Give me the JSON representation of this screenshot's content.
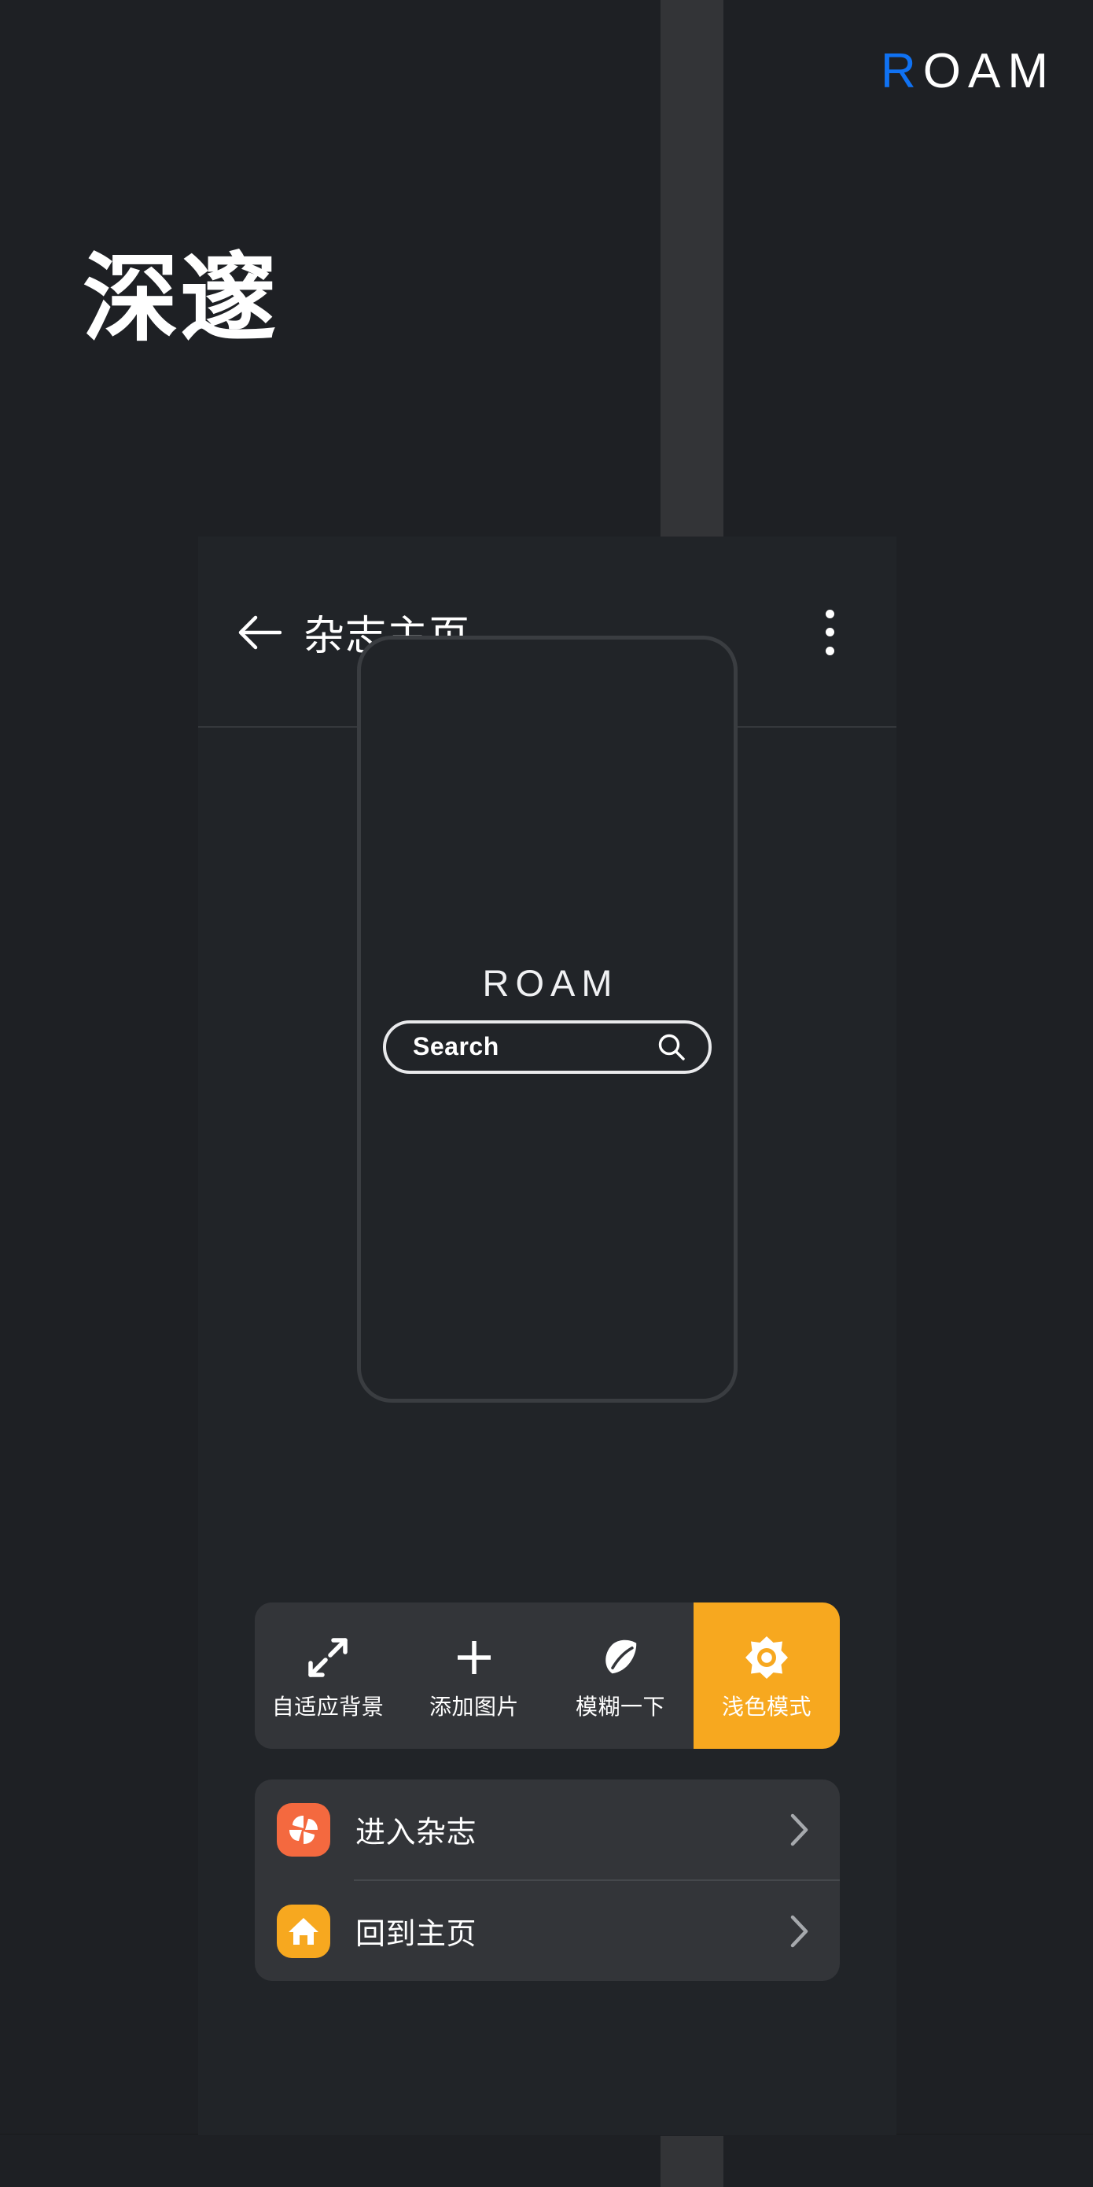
{
  "brand": {
    "accent_letter": "R",
    "rest": "OAM",
    "accent_color": "#1072f3"
  },
  "hero": {
    "title": "深邃"
  },
  "card": {
    "header": {
      "back_icon": "arrow-left-icon",
      "title": "杂志主页",
      "overflow_icon": "kebab-menu-icon"
    },
    "preview": {
      "logo": "ROAM",
      "search_placeholder": "Search",
      "search_value": "Search",
      "search_icon": "search-icon"
    },
    "toolbar": {
      "active_color": "#f7a81f",
      "items": [
        {
          "icon": "expand-arrows-icon",
          "label": "自适应背景",
          "active": false
        },
        {
          "icon": "plus-icon",
          "label": "添加图片",
          "active": false
        },
        {
          "icon": "leaf-icon",
          "label": "模糊一下",
          "active": false
        },
        {
          "icon": "brightness-sun-icon",
          "label": "浅色模式",
          "active": true
        }
      ]
    },
    "actions": [
      {
        "icon": "pinwheel-icon",
        "icon_color": "#f4693f",
        "label": "进入杂志",
        "chevron": "chevron-right-icon"
      },
      {
        "icon": "home-icon",
        "icon_color": "#f7a81f",
        "label": "回到主页",
        "chevron": "chevron-right-icon"
      }
    ]
  }
}
